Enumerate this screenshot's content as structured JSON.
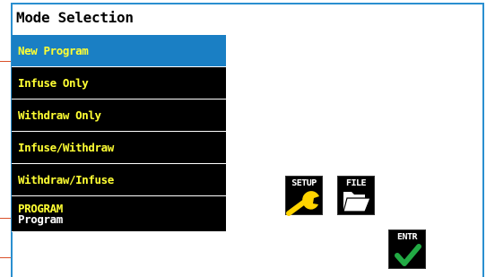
{
  "screen": {
    "title": "Mode Selection"
  },
  "menu": {
    "items": [
      {
        "label": "New Program",
        "selected": true
      },
      {
        "label": "Infuse Only",
        "selected": false
      },
      {
        "label": "Withdraw Only",
        "selected": false
      },
      {
        "label": "Infuse/Withdraw",
        "selected": false
      },
      {
        "label": "Withdraw/Infuse",
        "selected": false
      },
      {
        "label": "PROGRAM",
        "sub": "Program",
        "selected": false
      }
    ]
  },
  "buttons": {
    "setup": {
      "label": "SETUP",
      "icon": "wrench-icon"
    },
    "file": {
      "label": "FILE",
      "icon": "folder-icon"
    },
    "enter": {
      "label": "ENTR",
      "icon": "checkmark-icon"
    }
  },
  "colors": {
    "accent": "#1a7fc4",
    "border": "#2a8fd0",
    "menu_text": "#ffff33",
    "wrench": "#ffd400",
    "check": "#22aa44"
  }
}
